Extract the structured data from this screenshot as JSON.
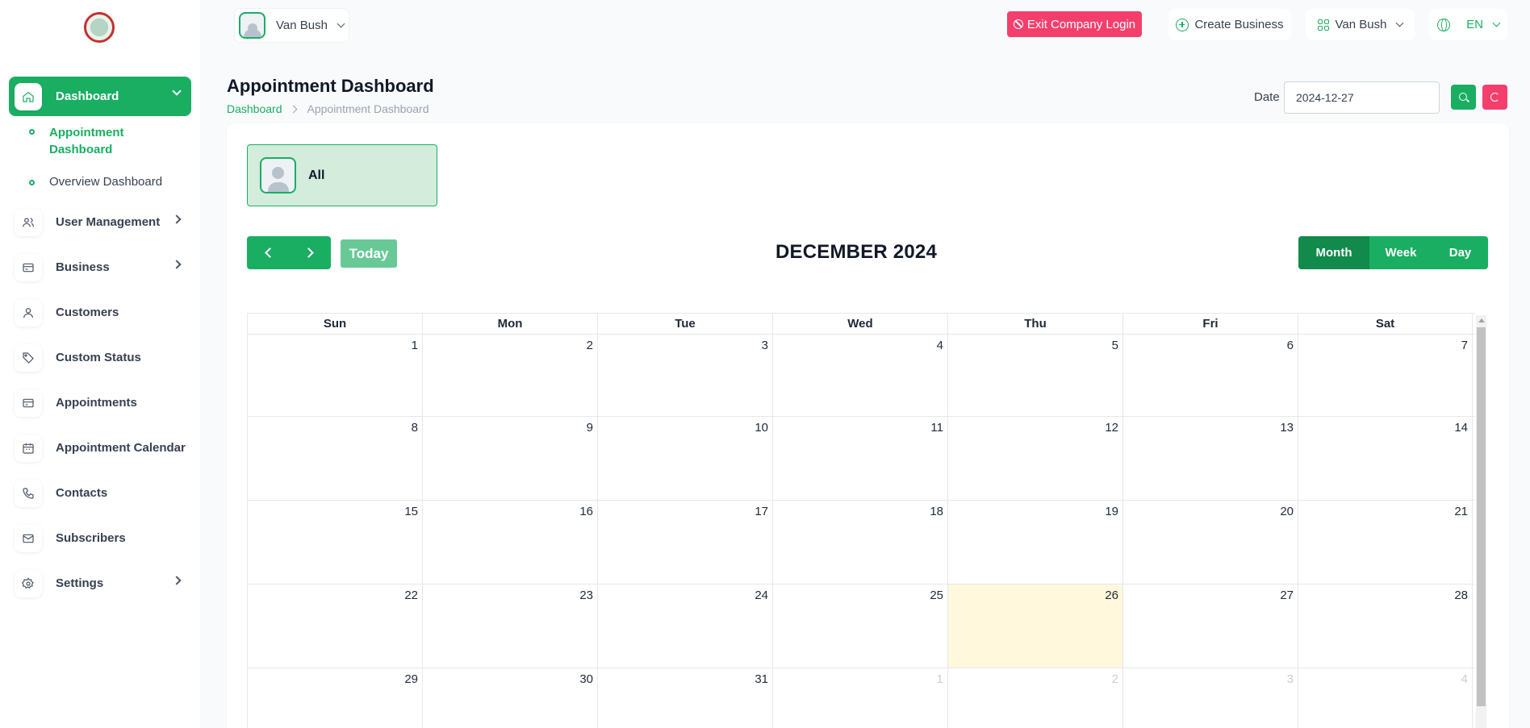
{
  "sidebar": {
    "items": [
      {
        "label": "Dashboard",
        "icon": "home-icon"
      },
      {
        "label": "User Management",
        "icon": "users-icon"
      },
      {
        "label": "Business",
        "icon": "card-icon"
      },
      {
        "label": "Customers",
        "icon": "user-icon"
      },
      {
        "label": "Custom Status",
        "icon": "tag-icon"
      },
      {
        "label": "Appointments",
        "icon": "card-icon"
      },
      {
        "label": "Appointment Calendar",
        "icon": "calendar-icon"
      },
      {
        "label": "Contacts",
        "icon": "phone-icon"
      },
      {
        "label": "Subscribers",
        "icon": "mail-icon"
      },
      {
        "label": "Settings",
        "icon": "gear-icon"
      }
    ],
    "sub_items": [
      {
        "label": "Appointment Dashboard"
      },
      {
        "label": "Overview Dashboard"
      }
    ]
  },
  "topbar": {
    "user_name": "Van Bush",
    "exit_label": "Exit Company Login",
    "create_label": "Create Business",
    "business_name": "Van Bush",
    "language": "EN"
  },
  "header": {
    "title": "Appointment Dashboard",
    "breadcrumb": [
      "Dashboard",
      "Appointment Dashboard"
    ],
    "date_label": "Date",
    "date_value": "2024-12-27"
  },
  "staff_filter": {
    "label": "All"
  },
  "calendar": {
    "title": "DECEMBER 2024",
    "today_label": "Today",
    "views": [
      "Month",
      "Week",
      "Day"
    ],
    "active_view": "Month",
    "weekdays": [
      "Sun",
      "Mon",
      "Tue",
      "Wed",
      "Thu",
      "Fri",
      "Sat"
    ],
    "weeks": [
      [
        "1",
        "2",
        "3",
        "4",
        "5",
        "6",
        "7"
      ],
      [
        "8",
        "9",
        "10",
        "11",
        "12",
        "13",
        "14"
      ],
      [
        "15",
        "16",
        "17",
        "18",
        "19",
        "20",
        "21"
      ],
      [
        "22",
        "23",
        "24",
        "25",
        "26",
        "27",
        "28"
      ],
      [
        "29",
        "30",
        "31",
        "1",
        "2",
        "3",
        "4"
      ]
    ],
    "today_date": "26",
    "colors": {
      "accent": "#1aae63",
      "danger": "#f43f6c",
      "today": "#fff8dc"
    }
  }
}
